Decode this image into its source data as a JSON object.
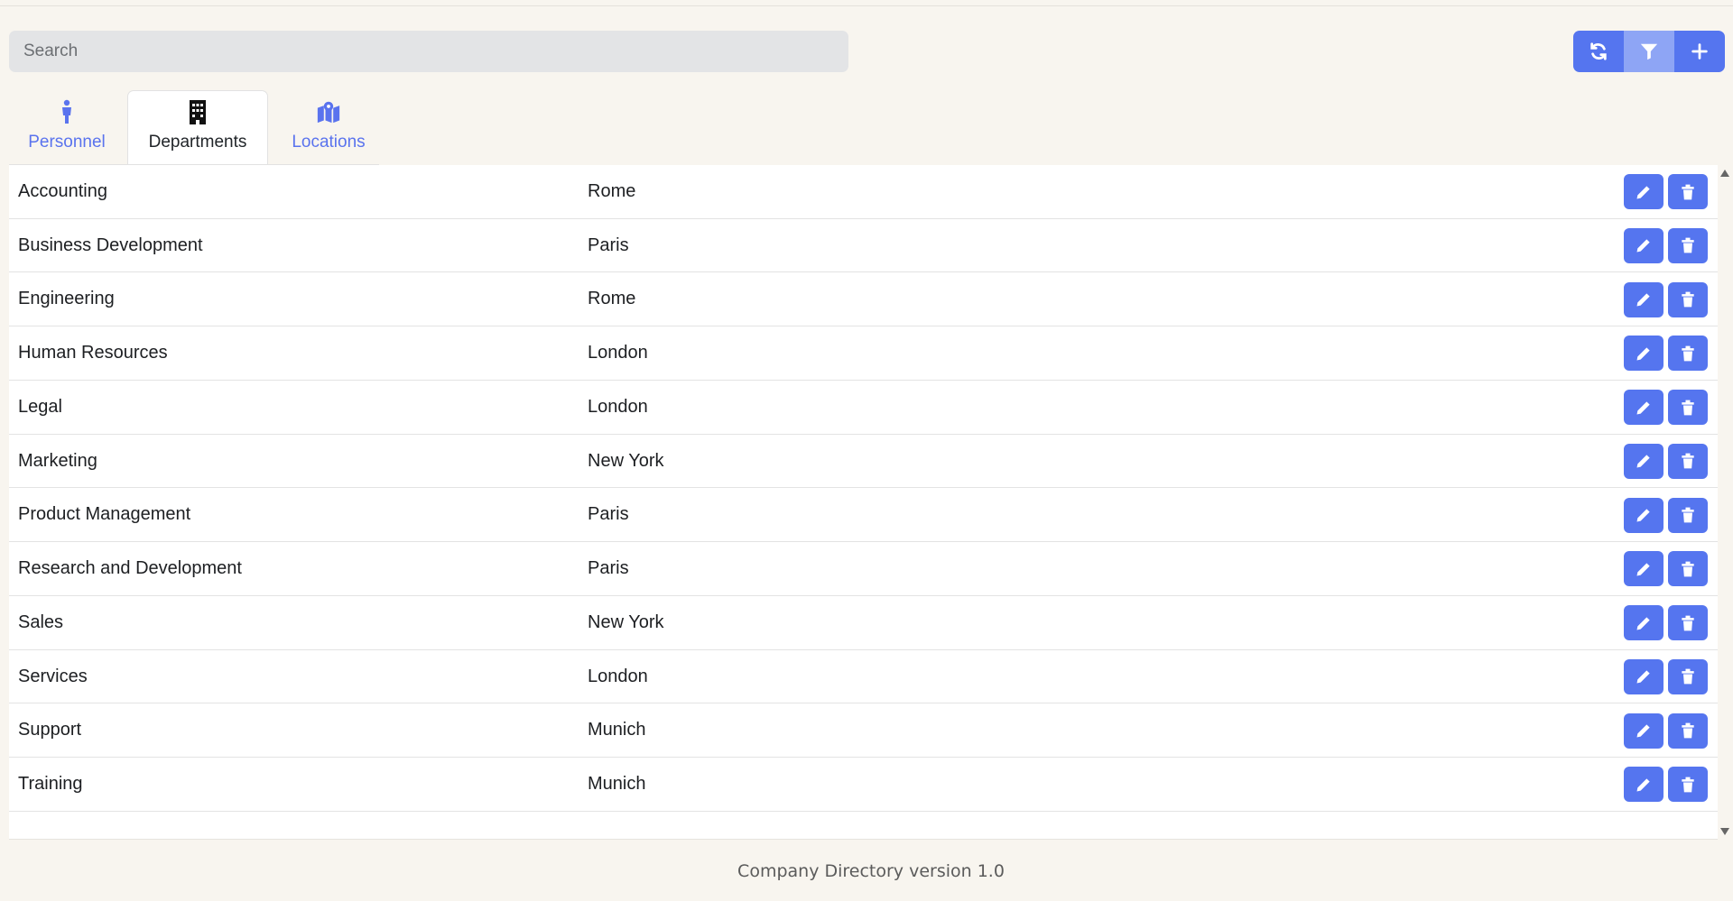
{
  "search": {
    "placeholder": "Search",
    "value": ""
  },
  "toolbar": {
    "refresh_icon": "refresh-icon",
    "filter_icon": "filter-icon",
    "add_icon": "plus-icon",
    "accent": "#5575ef",
    "filter_bg": "#8ea5f5"
  },
  "tabs": [
    {
      "label": "Personnel",
      "icon": "person-icon",
      "active": false
    },
    {
      "label": "Departments",
      "icon": "building-icon",
      "active": true
    },
    {
      "label": "Locations",
      "icon": "map-location-icon",
      "active": false
    }
  ],
  "rows": [
    {
      "name": "Accounting",
      "location": "Rome"
    },
    {
      "name": "Business Development",
      "location": "Paris"
    },
    {
      "name": "Engineering",
      "location": "Rome"
    },
    {
      "name": "Human Resources",
      "location": "London"
    },
    {
      "name": "Legal",
      "location": "London"
    },
    {
      "name": "Marketing",
      "location": "New York"
    },
    {
      "name": "Product Management",
      "location": "Paris"
    },
    {
      "name": "Research and Development",
      "location": "Paris"
    },
    {
      "name": "Sales",
      "location": "New York"
    },
    {
      "name": "Services",
      "location": "London"
    },
    {
      "name": "Support",
      "location": "Munich"
    },
    {
      "name": "Training",
      "location": "Munich"
    }
  ],
  "row_actions": {
    "edit_icon": "pencil-icon",
    "delete_icon": "trash-icon"
  },
  "footer": {
    "text": "Company Directory version 1.0"
  },
  "colors": {
    "background": "#f8f5ef",
    "accent": "#5575ef",
    "tab_text": "#5a73ee"
  }
}
